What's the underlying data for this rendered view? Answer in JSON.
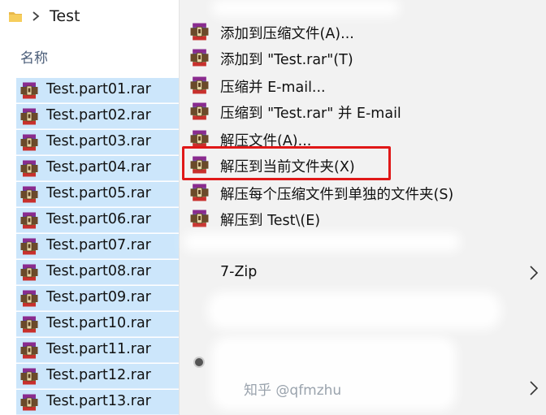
{
  "explorer": {
    "breadcrumb": "Test",
    "column_header": "名称",
    "files": [
      "Test.part01.rar",
      "Test.part02.rar",
      "Test.part03.rar",
      "Test.part04.rar",
      "Test.part05.rar",
      "Test.part06.rar",
      "Test.part07.rar",
      "Test.part08.rar",
      "Test.part09.rar",
      "Test.part10.rar",
      "Test.part11.rar",
      "Test.part12.rar",
      "Test.part13.rar"
    ],
    "selection_color": "#cce6fb"
  },
  "context_menu": {
    "items": [
      {
        "label": "添加到压缩文件(A)...",
        "icon": "winrar-icon"
      },
      {
        "label": "添加到 \"Test.rar\"(T)",
        "icon": "winrar-icon"
      },
      {
        "label": "压缩并 E-mail...",
        "icon": "winrar-icon"
      },
      {
        "label": "压缩到 \"Test.rar\" 并 E-mail",
        "icon": "winrar-icon"
      },
      {
        "label": "解压文件(A)...",
        "icon": "winrar-icon"
      },
      {
        "label": "解压到当前文件夹(X)",
        "icon": "winrar-icon",
        "highlighted": true
      },
      {
        "label": "解压每个压缩文件到单独的文件夹(S)",
        "icon": "winrar-icon"
      },
      {
        "label": "解压到 Test\\(E)",
        "icon": "winrar-icon"
      }
    ],
    "submenu_7zip": "7-Zip",
    "highlight_color": "#e01818",
    "background": "#f2f2f2"
  },
  "watermark": "知乎 @qfmzhu"
}
